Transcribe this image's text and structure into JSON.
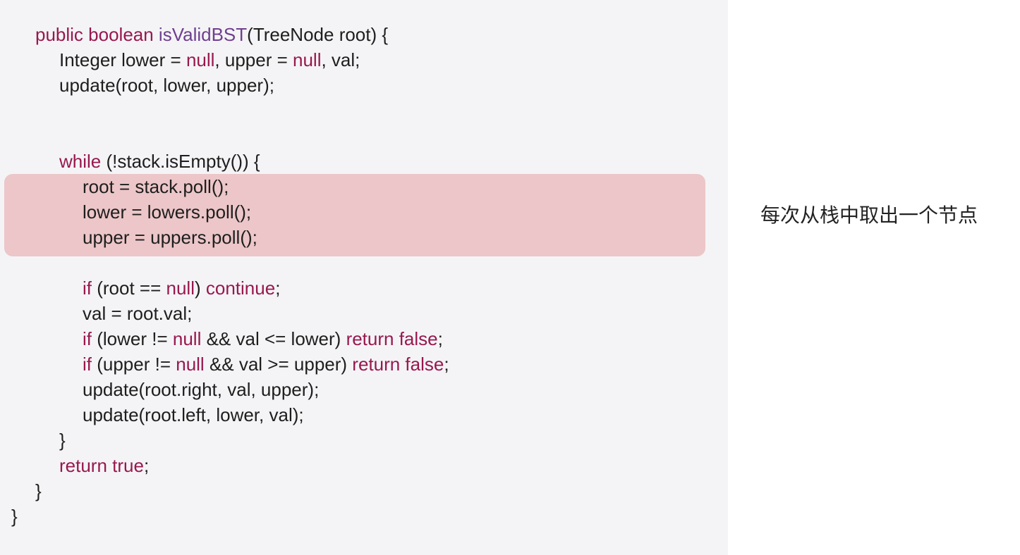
{
  "code": {
    "lines": [
      {
        "segs": [
          {
            "t": "public boolean ",
            "k": "kw"
          },
          {
            "t": "isValidBST",
            "k": "fn"
          },
          {
            "t": "(TreeNode root) {",
            "k": "p"
          }
        ]
      },
      {
        "segs": [
          {
            "t": "Integer lower = ",
            "k": "p"
          },
          {
            "t": "null",
            "k": "kw"
          },
          {
            "t": ", upper = ",
            "k": "p"
          },
          {
            "t": "null",
            "k": "kw"
          },
          {
            "t": ", val;",
            "k": "p"
          }
        ]
      },
      {
        "segs": [
          {
            "t": "update(root, lower, upper);",
            "k": "p"
          }
        ]
      },
      {
        "segs": [
          {
            "t": "while",
            "k": "kw"
          },
          {
            "t": " (!stack.isEmpty()) {",
            "k": "p"
          }
        ]
      },
      {
        "segs": [
          {
            "t": "root = stack.poll();",
            "k": "p"
          }
        ]
      },
      {
        "segs": [
          {
            "t": "lower = lowers.poll();",
            "k": "p"
          }
        ]
      },
      {
        "segs": [
          {
            "t": "upper = uppers.poll();",
            "k": "p"
          }
        ]
      },
      {
        "segs": [
          {
            "t": "if",
            "k": "kw"
          },
          {
            "t": " (root == ",
            "k": "p"
          },
          {
            "t": "null",
            "k": "kw"
          },
          {
            "t": ") ",
            "k": "p"
          },
          {
            "t": "continue",
            "k": "kw"
          },
          {
            "t": ";",
            "k": "p"
          }
        ]
      },
      {
        "segs": [
          {
            "t": "val = root.val;",
            "k": "p"
          }
        ]
      },
      {
        "segs": [
          {
            "t": "if",
            "k": "kw"
          },
          {
            "t": " (lower != ",
            "k": "p"
          },
          {
            "t": "null",
            "k": "kw"
          },
          {
            "t": " && val <= lower) ",
            "k": "p"
          },
          {
            "t": "return false",
            "k": "kw"
          },
          {
            "t": ";",
            "k": "p"
          }
        ]
      },
      {
        "segs": [
          {
            "t": "if",
            "k": "kw"
          },
          {
            "t": " (upper != ",
            "k": "p"
          },
          {
            "t": "null",
            "k": "kw"
          },
          {
            "t": " && val >= upper) ",
            "k": "p"
          },
          {
            "t": "return false",
            "k": "kw"
          },
          {
            "t": ";",
            "k": "p"
          }
        ]
      },
      {
        "segs": [
          {
            "t": "update(root.right, val, upper);",
            "k": "p"
          }
        ]
      },
      {
        "segs": [
          {
            "t": "update(root.left, lower, val);",
            "k": "p"
          }
        ]
      },
      {
        "segs": [
          {
            "t": "}",
            "k": "p"
          }
        ]
      },
      {
        "segs": [
          {
            "t": "return true",
            "k": "kw"
          },
          {
            "t": ";",
            "k": "p"
          }
        ]
      },
      {
        "segs": [
          {
            "t": "}",
            "k": "p"
          }
        ]
      },
      {
        "segs": [
          {
            "t": "}",
            "k": "p"
          }
        ]
      }
    ]
  },
  "annotation": "每次从栈中取出一个节点",
  "colors": {
    "keyword": "#98184f",
    "method": "#6f3f8f",
    "highlight": "#ecc6c8",
    "panel": "#f4f4f6"
  }
}
